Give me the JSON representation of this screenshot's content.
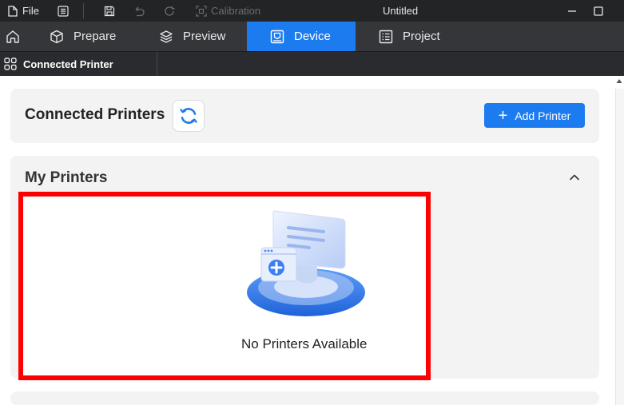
{
  "titlebar": {
    "file_label": "File",
    "calibration_label": "Calibration",
    "window_title": "Untitled"
  },
  "tabs": {
    "prepare": "Prepare",
    "preview": "Preview",
    "device": "Device",
    "project": "Project"
  },
  "subtab": {
    "label": "Connected Printer"
  },
  "connected": {
    "title": "Connected Printers",
    "add_label": "Add Printer"
  },
  "my_printers": {
    "title": "My Printers",
    "empty_text": "No Printers Available"
  },
  "colors": {
    "accent": "#1d7bf0",
    "highlight_border": "#ff0000",
    "titlebar_bg": "#232426",
    "tabbar_bg": "#34363a"
  }
}
